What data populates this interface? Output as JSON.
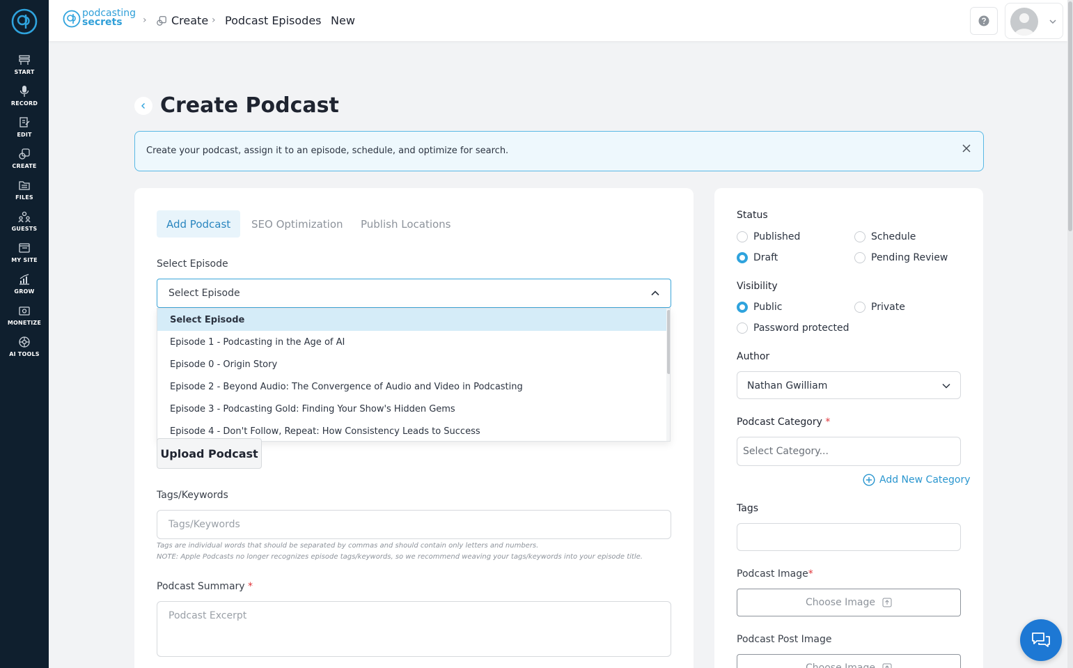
{
  "sidebar": {
    "items": [
      {
        "label": "START",
        "icon": "start-icon"
      },
      {
        "label": "RECORD",
        "icon": "microphone-icon"
      },
      {
        "label": "EDIT",
        "icon": "edit-icon"
      },
      {
        "label": "CREATE",
        "icon": "create-icon"
      },
      {
        "label": "FILES",
        "icon": "files-icon"
      },
      {
        "label": "GUESTS",
        "icon": "guests-icon"
      },
      {
        "label": "MY SITE",
        "icon": "my-site-icon"
      },
      {
        "label": "GROW",
        "icon": "grow-icon"
      },
      {
        "label": "MONETIZE",
        "icon": "monetize-icon"
      },
      {
        "label": "AI TOOLS",
        "icon": "ai-tools-icon"
      }
    ]
  },
  "header": {
    "brand_line1": "podcasting",
    "brand_line2": "secrets",
    "breadcrumb": [
      "Create",
      "Podcast Episodes",
      "New"
    ]
  },
  "page": {
    "title": "Create Podcast",
    "info": "Create your podcast, assign it to an episode, schedule, and optimize for search."
  },
  "tabs": [
    {
      "label": "Add Podcast",
      "active": true
    },
    {
      "label": "SEO Optimization",
      "active": false
    },
    {
      "label": "Publish Locations",
      "active": false
    }
  ],
  "episode": {
    "label": "Select Episode",
    "value": "Select Episode",
    "options": [
      "Select Episode",
      "Episode 1 - Podcasting in the Age of AI",
      "Episode 0 - Origin Story",
      "Episode 2 - Beyond Audio: The Convergence of Audio and Video in Podcasting",
      "Episode 3 - Podcasting Gold: Finding Your Show's Hidden Gems",
      "Episode 4 - Don't Follow, Repeat: How Consistency Leads to Success"
    ]
  },
  "upload_label": "Upload Podcast",
  "tags_field": {
    "label": "Tags/Keywords",
    "placeholder": "Tags/Keywords",
    "hint1": "Tags are individual words that should be separated by commas and should contain only letters and numbers.",
    "hint2": "NOTE: Apple Podcasts no longer recognizes episode tags/keywords, so we recommend weaving your tags/keywords into your episode title."
  },
  "summary": {
    "label": "Podcast Summary",
    "required": "*",
    "placeholder": "Podcast Excerpt"
  },
  "status": {
    "label": "Status",
    "options": [
      "Published",
      "Schedule",
      "Draft",
      "Pending Review"
    ],
    "selected": "Draft"
  },
  "visibility": {
    "label": "Visibility",
    "options": [
      "Public",
      "Private",
      "Password protected"
    ],
    "selected": "Public"
  },
  "author": {
    "label": "Author",
    "value": "Nathan Gwilliam"
  },
  "category": {
    "label": "Podcast Category",
    "required": "*",
    "placeholder": "Select Category...",
    "add_label": "Add New Category"
  },
  "tags_right": {
    "label": "Tags"
  },
  "podcast_image": {
    "label": "Podcast Image",
    "required": "*",
    "button": "Choose Image"
  },
  "post_image": {
    "label": "Podcast Post Image",
    "button": "Choose Image"
  },
  "colors": {
    "accent": "#2fa3dd",
    "sidebar": "#0f1f2e",
    "required": "#e0363b"
  }
}
